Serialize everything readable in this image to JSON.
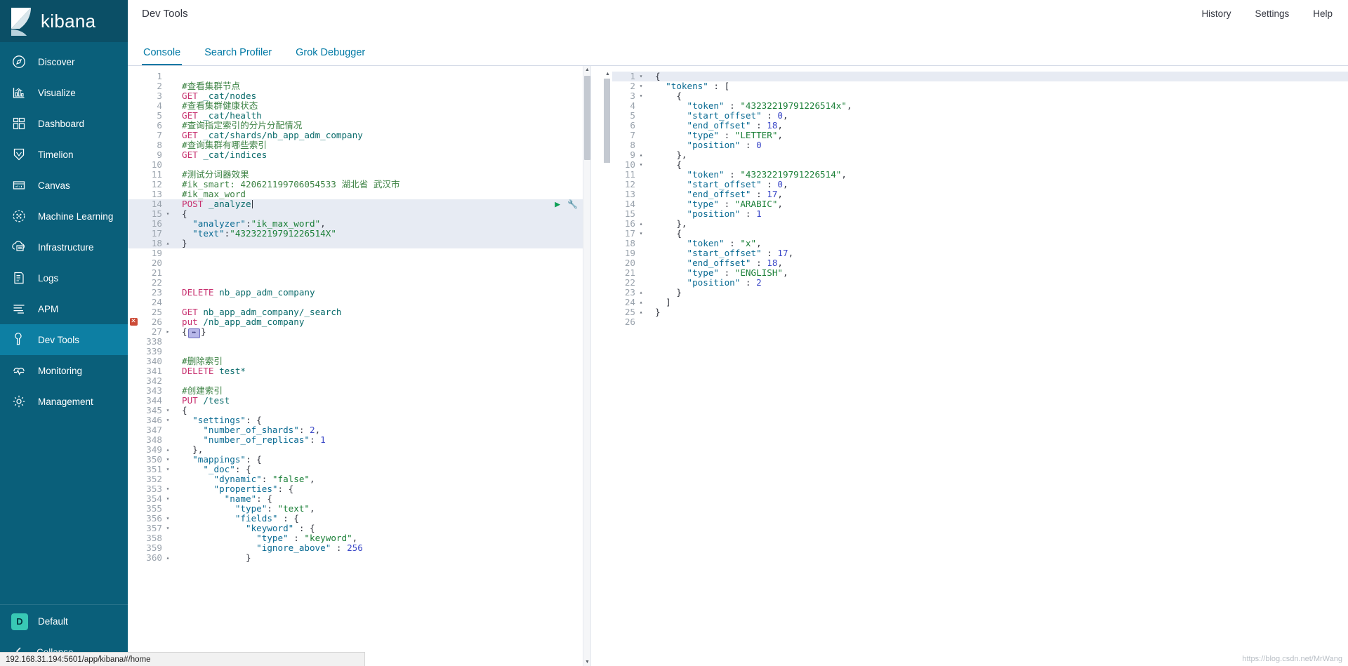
{
  "brand": {
    "name": "kibana"
  },
  "sidebar": {
    "items": [
      {
        "label": "Discover",
        "icon": "compass-icon",
        "active": false
      },
      {
        "label": "Visualize",
        "icon": "bar-chart-icon",
        "active": false
      },
      {
        "label": "Dashboard",
        "icon": "dashboard-icon",
        "active": false
      },
      {
        "label": "Timelion",
        "icon": "timelion-icon",
        "active": false
      },
      {
        "label": "Canvas",
        "icon": "canvas-icon",
        "active": false
      },
      {
        "label": "Machine Learning",
        "icon": "machine-learning-icon",
        "active": false
      },
      {
        "label": "Infrastructure",
        "icon": "infrastructure-icon",
        "active": false
      },
      {
        "label": "Logs",
        "icon": "logs-icon",
        "active": false
      },
      {
        "label": "APM",
        "icon": "apm-icon",
        "active": false
      },
      {
        "label": "Dev Tools",
        "icon": "wrench-icon",
        "active": true
      },
      {
        "label": "Monitoring",
        "icon": "monitoring-icon",
        "active": false
      },
      {
        "label": "Management",
        "icon": "gear-icon",
        "active": false
      }
    ],
    "space": {
      "badge": "D",
      "label": "Default"
    },
    "collapse": {
      "label": "Collapse",
      "icon": "chevron-left-icon"
    }
  },
  "header": {
    "app_title": "Dev Tools",
    "links": [
      "History",
      "Settings",
      "Help"
    ]
  },
  "tabs": [
    {
      "label": "Console",
      "active": true
    },
    {
      "label": "Search Profiler",
      "active": false
    },
    {
      "label": "Grok Debugger",
      "active": false
    }
  ],
  "request_actions": {
    "play": "play-icon",
    "wrench": "wrench-icon"
  },
  "editor": {
    "lines": [
      {
        "n": 1,
        "text": "",
        "cls": ""
      },
      {
        "n": 2,
        "text": "#查看集群节点",
        "cls": "c-comment"
      },
      {
        "n": 3,
        "text": "GET _cat/nodes",
        "cls": "method-url"
      },
      {
        "n": 4,
        "text": "#查看集群健康状态",
        "cls": "c-comment"
      },
      {
        "n": 5,
        "text": "GET _cat/health",
        "cls": "method-url"
      },
      {
        "n": 6,
        "text": "#查询指定索引的分片分配情况",
        "cls": "c-comment"
      },
      {
        "n": 7,
        "text": "GET _cat/shards/nb_app_adm_company",
        "cls": "method-url"
      },
      {
        "n": 8,
        "text": "#查询集群有哪些索引",
        "cls": "c-comment"
      },
      {
        "n": 9,
        "text": "GET _cat/indices",
        "cls": "method-url"
      },
      {
        "n": 10,
        "text": "",
        "cls": ""
      },
      {
        "n": 11,
        "text": "#测试分词器效果",
        "cls": "c-comment"
      },
      {
        "n": 12,
        "text": "#ik_smart: 420621199706054533 湖北省 武汉市",
        "cls": "c-comment"
      },
      {
        "n": 13,
        "text": "#ik_max_word",
        "cls": "c-comment"
      },
      {
        "n": 14,
        "text": "POST _analyze",
        "cls": "method-url",
        "cursor": true,
        "highlight": true,
        "actions": true
      },
      {
        "n": 15,
        "text": "{",
        "cls": "c-punct",
        "fold": "down",
        "highlight": true
      },
      {
        "n": 16,
        "text": "  \"analyzer\":\"ik_max_word\",",
        "cls": "json",
        "highlight": true
      },
      {
        "n": 17,
        "text": "  \"text\":\"43232219791226514X\"",
        "cls": "json",
        "highlight": true
      },
      {
        "n": 18,
        "text": "}",
        "cls": "c-punct",
        "fold": "up",
        "highlight": true
      },
      {
        "n": 19,
        "text": "",
        "cls": ""
      },
      {
        "n": 20,
        "text": "",
        "cls": ""
      },
      {
        "n": 21,
        "text": "",
        "cls": ""
      },
      {
        "n": 22,
        "text": "",
        "cls": ""
      },
      {
        "n": 23,
        "text": "DELETE nb_app_adm_company",
        "cls": "method-url"
      },
      {
        "n": 24,
        "text": "",
        "cls": ""
      },
      {
        "n": 25,
        "text": "GET nb_app_adm_company/_search",
        "cls": "method-url"
      },
      {
        "n": 26,
        "text": "put /nb_app_adm_company",
        "cls": "method-url",
        "error": true
      },
      {
        "n": 27,
        "text": "{ ⇄ }",
        "cls": "folded",
        "fold": "right"
      },
      {
        "n": 338,
        "text": "",
        "cls": ""
      },
      {
        "n": 339,
        "text": "",
        "cls": ""
      },
      {
        "n": 340,
        "text": "#删除索引",
        "cls": "c-comment"
      },
      {
        "n": 341,
        "text": "DELETE test*",
        "cls": "method-url"
      },
      {
        "n": 342,
        "text": "",
        "cls": ""
      },
      {
        "n": 343,
        "text": "#创建索引",
        "cls": "c-comment"
      },
      {
        "n": 344,
        "text": "PUT /test",
        "cls": "method-url"
      },
      {
        "n": 345,
        "text": "{",
        "cls": "c-punct",
        "fold": "down"
      },
      {
        "n": 346,
        "text": "  \"settings\": {",
        "cls": "json",
        "fold": "down",
        "indent": 1
      },
      {
        "n": 347,
        "text": "    \"number_of_shards\": 2,",
        "cls": "json",
        "indent": 2
      },
      {
        "n": 348,
        "text": "    \"number_of_replicas\": 1",
        "cls": "json",
        "indent": 2
      },
      {
        "n": 349,
        "text": "  },",
        "cls": "c-punct",
        "fold": "up",
        "indent": 1
      },
      {
        "n": 350,
        "text": "  \"mappings\": {",
        "cls": "json",
        "fold": "down",
        "indent": 1
      },
      {
        "n": 351,
        "text": "    \"_doc\": {",
        "cls": "json",
        "fold": "down",
        "indent": 2
      },
      {
        "n": 352,
        "text": "      \"dynamic\": \"false\",",
        "cls": "json",
        "indent": 3
      },
      {
        "n": 353,
        "text": "      \"properties\": {",
        "cls": "json",
        "fold": "down",
        "indent": 3
      },
      {
        "n": 354,
        "text": "        \"name\": {",
        "cls": "json",
        "fold": "down",
        "indent": 4
      },
      {
        "n": 355,
        "text": "          \"type\": \"text\",",
        "cls": "json",
        "indent": 5
      },
      {
        "n": 356,
        "text": "          \"fields\" : {",
        "cls": "json",
        "fold": "down",
        "indent": 5
      },
      {
        "n": 357,
        "text": "            \"keyword\" : {",
        "cls": "json",
        "fold": "down",
        "indent": 6
      },
      {
        "n": 358,
        "text": "              \"type\" : \"keyword\",",
        "cls": "json",
        "indent": 7
      },
      {
        "n": 359,
        "text": "              \"ignore_above\" : 256",
        "cls": "json",
        "indent": 7
      },
      {
        "n": 360,
        "text": "            }",
        "cls": "c-punct",
        "fold": "up",
        "indent": 6
      }
    ]
  },
  "response": {
    "lines": [
      {
        "n": 1,
        "text": "{",
        "cls": "c-punct",
        "fold": "down",
        "highlight": true
      },
      {
        "n": 2,
        "text": "  \"tokens\" : [",
        "cls": "json",
        "fold": "down"
      },
      {
        "n": 3,
        "text": "    {",
        "cls": "c-punct",
        "fold": "down",
        "indent": 1
      },
      {
        "n": 4,
        "text": "      \"token\" : \"43232219791226514x\",",
        "cls": "json",
        "indent": 2
      },
      {
        "n": 5,
        "text": "      \"start_offset\" : 0,",
        "cls": "json",
        "indent": 2
      },
      {
        "n": 6,
        "text": "      \"end_offset\" : 18,",
        "cls": "json",
        "indent": 2
      },
      {
        "n": 7,
        "text": "      \"type\" : \"LETTER\",",
        "cls": "json",
        "indent": 2
      },
      {
        "n": 8,
        "text": "      \"position\" : 0",
        "cls": "json",
        "indent": 2
      },
      {
        "n": 9,
        "text": "    },",
        "cls": "c-punct",
        "fold": "up",
        "indent": 1
      },
      {
        "n": 10,
        "text": "    {",
        "cls": "c-punct",
        "fold": "down",
        "indent": 1
      },
      {
        "n": 11,
        "text": "      \"token\" : \"43232219791226514\",",
        "cls": "json",
        "indent": 2
      },
      {
        "n": 12,
        "text": "      \"start_offset\" : 0,",
        "cls": "json",
        "indent": 2
      },
      {
        "n": 13,
        "text": "      \"end_offset\" : 17,",
        "cls": "json",
        "indent": 2
      },
      {
        "n": 14,
        "text": "      \"type\" : \"ARABIC\",",
        "cls": "json",
        "indent": 2
      },
      {
        "n": 15,
        "text": "      \"position\" : 1",
        "cls": "json",
        "indent": 2
      },
      {
        "n": 16,
        "text": "    },",
        "cls": "c-punct",
        "fold": "up",
        "indent": 1
      },
      {
        "n": 17,
        "text": "    {",
        "cls": "c-punct",
        "fold": "down",
        "indent": 1
      },
      {
        "n": 18,
        "text": "      \"token\" : \"x\",",
        "cls": "json",
        "indent": 2
      },
      {
        "n": 19,
        "text": "      \"start_offset\" : 17,",
        "cls": "json",
        "indent": 2
      },
      {
        "n": 20,
        "text": "      \"end_offset\" : 18,",
        "cls": "json",
        "indent": 2
      },
      {
        "n": 21,
        "text": "      \"type\" : \"ENGLISH\",",
        "cls": "json",
        "indent": 2
      },
      {
        "n": 22,
        "text": "      \"position\" : 2",
        "cls": "json",
        "indent": 2
      },
      {
        "n": 23,
        "text": "    }",
        "cls": "c-punct",
        "fold": "up",
        "indent": 1
      },
      {
        "n": 24,
        "text": "  ]",
        "cls": "c-punct",
        "fold": "up"
      },
      {
        "n": 25,
        "text": "}",
        "cls": "c-punct",
        "fold": "up"
      },
      {
        "n": 26,
        "text": "",
        "cls": ""
      }
    ]
  },
  "statusbar": {
    "url": "192.168.31.194:5601/app/kibana#/home"
  },
  "watermark": {
    "text": "https://blog.csdn.net/MrWang"
  },
  "colors": {
    "sidebar_bg": "#0a5f7a",
    "sidebar_active": "#0d7fa3",
    "brand_bg": "#0b4f66",
    "accent_link": "#0079a5",
    "comment": "#3c8243",
    "method": "#c7306f",
    "url": "#0a6b6b",
    "json_key": "#0a6b93",
    "json_string": "#1a7f37",
    "json_number": "#3b48c7",
    "error_marker": "#cc4b37",
    "selection_bg": "#e7ebf3",
    "space_badge": "#38c8b5"
  }
}
